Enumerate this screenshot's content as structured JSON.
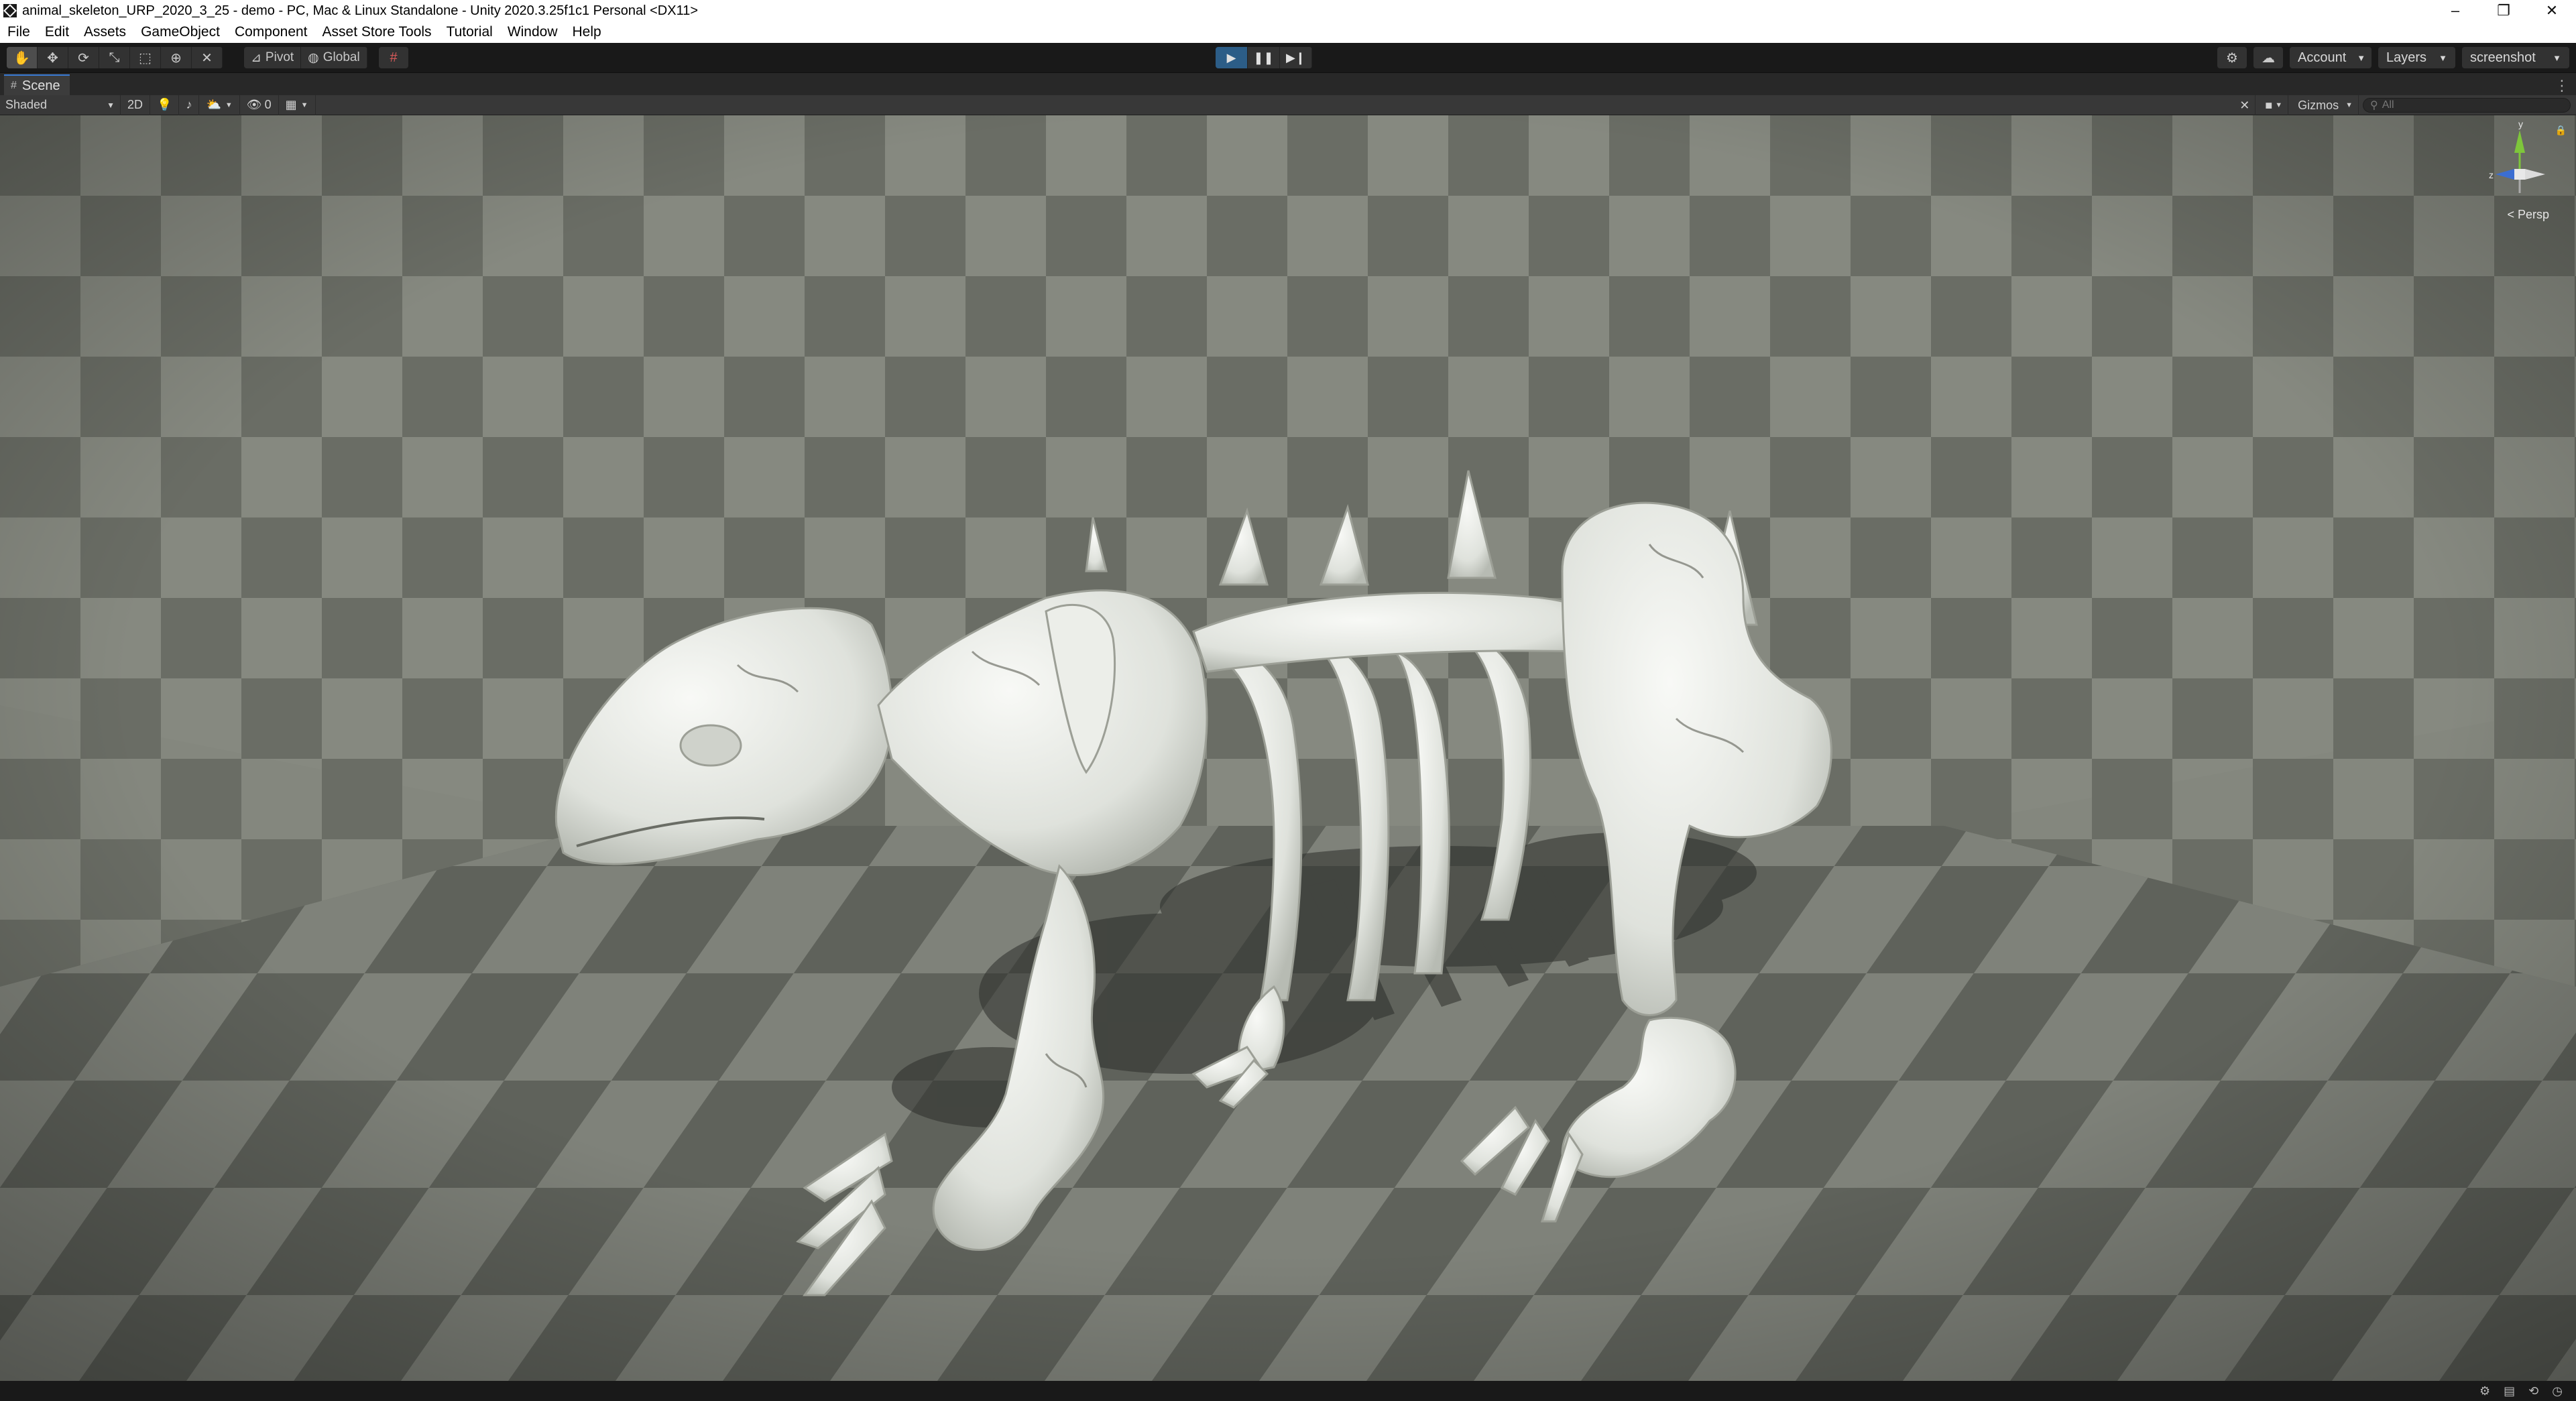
{
  "window": {
    "title": "animal_skeleton_URP_2020_3_25 - demo - PC, Mac & Linux Standalone - Unity 2020.3.25f1c1 Personal <DX11>",
    "minimize": "–",
    "maximize": "❐",
    "close": "✕"
  },
  "menu": [
    "File",
    "Edit",
    "Assets",
    "GameObject",
    "Component",
    "Asset Store Tools",
    "Tutorial",
    "Window",
    "Help"
  ],
  "toolbar": {
    "pivot_label": "Pivot",
    "global_label": "Global",
    "account_label": "Account",
    "layers_label": "Layers",
    "layout_label": "screenshot",
    "icons": [
      "hand-tool-icon",
      "move-tool-icon",
      "rotate-tool-icon",
      "scale-tool-icon",
      "rect-tool-icon",
      "transform-tool-icon",
      "custom-tool-icon"
    ]
  },
  "scene_tab": {
    "label": "Scene"
  },
  "scene_toolbar": {
    "shading_mode": "Shaded",
    "mode_2d": "2D",
    "hidden_count": "0",
    "gizmos_label": "Gizmos",
    "search_placeholder": "All"
  },
  "viewport": {
    "gizmo_y": "y",
    "gizmo_z": "z",
    "projection_label": "< Persp"
  },
  "colors": {
    "play_active": "#2c5d87",
    "gizmo_y": "#7ec63b",
    "gizmo_x": "#d23b3b",
    "gizmo_z": "#3b6ed2",
    "bone": "#e9ebe6",
    "floor_light": "#7d8077",
    "floor_dark": "#5d6058"
  }
}
